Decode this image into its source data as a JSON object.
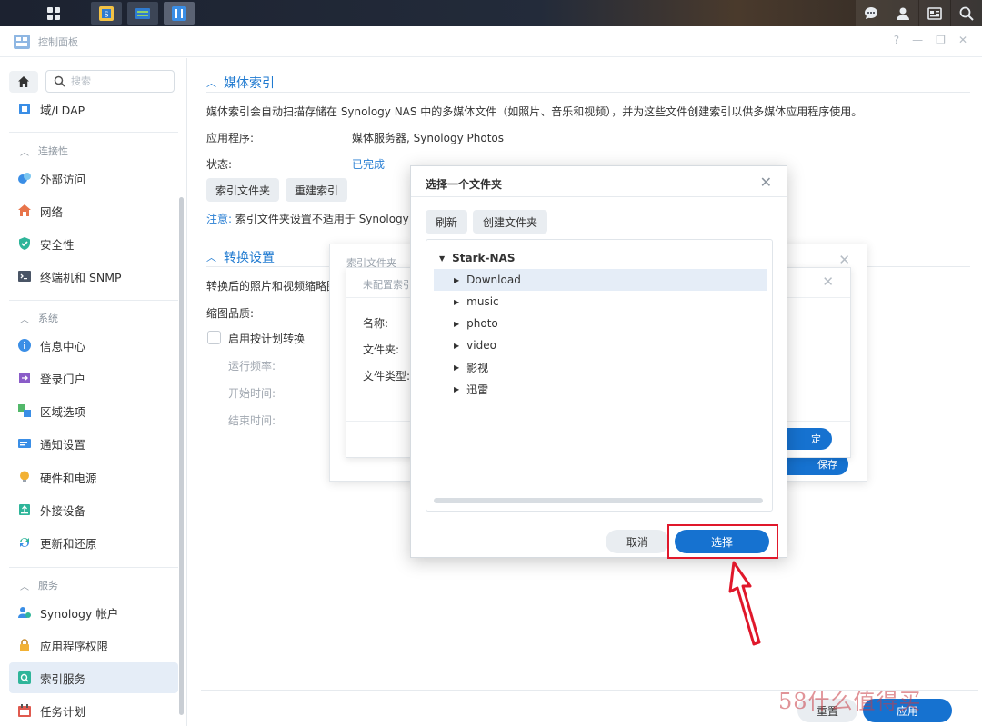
{
  "window": {
    "title": "控制面板",
    "controls": [
      "?",
      "—",
      "❐",
      "✕"
    ]
  },
  "sidebar": {
    "search_placeholder": "搜索",
    "top_item": "域/LDAP",
    "categories": {
      "connectivity": "连接性",
      "system": "系统",
      "services": "服务"
    },
    "connectivity_items": [
      "外部访问",
      "网络",
      "安全性",
      "终端机和 SNMP"
    ],
    "system_items": [
      "信息中心",
      "登录门户",
      "区域选项",
      "通知设置",
      "硬件和电源",
      "外接设备",
      "更新和还原"
    ],
    "service_items": [
      "Synology 帐户",
      "应用程序权限",
      "索引服务",
      "任务计划"
    ]
  },
  "main": {
    "media_index": {
      "heading": "媒体索引",
      "description": "媒体索引会自动扫描存储在 Synology NAS 中的多媒体文件（如照片、音乐和视频），并为这些文件创建索引以供多媒体应用程序使用。",
      "app_label": "应用程序:",
      "app_value": "媒体服务器, Synology Photos",
      "status_label": "状态:",
      "status_value": "已完成",
      "btn_index_folder": "索引文件夹",
      "btn_rebuild": "重建索引",
      "note_prefix": "注意:",
      "note_text": "索引文件夹设置不适用于 Synology P"
    },
    "conversion": {
      "heading": "转换设置",
      "description": "转换后的照片和视频缩略图",
      "quality_label": "缩图品质:",
      "schedule_checkbox": "启用按计划转换",
      "frequency_label": "运行频率:",
      "start_label": "开始时间:",
      "end_label": "结束时间:"
    },
    "footer": {
      "reset": "重置",
      "apply": "应用"
    }
  },
  "back_dialog_1": {
    "title": "索引文件夹",
    "save_btn": "保存"
  },
  "back_dialog_2": {
    "title": "未配置索引",
    "name_label": "名称:",
    "folder_label": "文件夹:",
    "filetype_label": "文件类型:",
    "ok_btn": "定"
  },
  "folder_dialog": {
    "title": "选择一个文件夹",
    "btn_refresh": "刷新",
    "btn_create": "创建文件夹",
    "root": "Stark-NAS",
    "folders": [
      "Download",
      "music",
      "photo",
      "video",
      "影视",
      "迅雷"
    ],
    "btn_cancel": "取消",
    "btn_select": "选择"
  },
  "watermark": "58什么值得买",
  "colors": {
    "accent": "#1672d0",
    "highlight": "#e0182b",
    "selected_row": "#e5edf7"
  }
}
